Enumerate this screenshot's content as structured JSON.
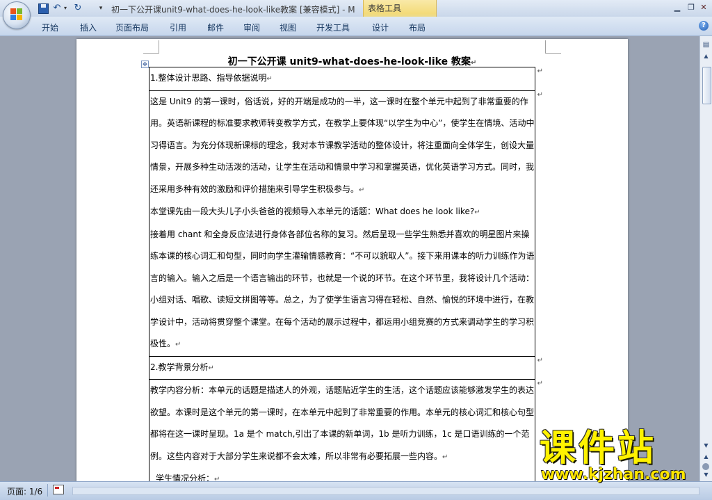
{
  "window": {
    "title": "初一下公开课unit9-what-does-he-look-like教案 [兼容模式] - M",
    "context_tab_group": "表格工具",
    "controls": {
      "minimize": "▁",
      "restore": "❐",
      "close": "✕"
    }
  },
  "quick_access": {
    "save_icon": "save-icon",
    "undo_glyph": "↶",
    "undo_drop": "▾",
    "redo_glyph": "↻",
    "more_glyph": "▾"
  },
  "ribbon": {
    "tabs": [
      "开始",
      "插入",
      "页面布局",
      "引用",
      "邮件",
      "审阅",
      "视图",
      "开发工具",
      "设计",
      "布局"
    ],
    "help_glyph": "?"
  },
  "document": {
    "heading": "初一下公开课 unit9-what-does-he-look-like 教案",
    "table_anchor_glyph": "✥",
    "para_mark": "↵",
    "rows": [
      {
        "paragraphs": [
          "1.整体设计思路、指导依据说明"
        ]
      },
      {
        "paragraphs": [
          "这是 Unit9 的第一课时，俗话说，好的开端是成功的一半，这一课时在整个单元中起到了非常重要的作用。英语新课程的标准要求教师转变教学方式，在教学上要体现“以学生为中心”，使学生在情境、活动中习得语言。为充分体现新课标的理念，我对本节课教学活动的整体设计，将注重面向全体学生，创设大量情景，开展多种生动活泼的活动，让学生在活动和情景中学习和掌握英语，优化英语学习方式。同时，我还采用多种有效的激励和评价措施来引导学生积极参与。",
          "本堂课先由一段大头儿子小头爸爸的视频导入本单元的话题：What does he look like?",
          "接着用 chant 和全身反应法进行身体各部位名称的复习。然后呈现一些学生熟悉并喜欢的明星图片来操练本课的核心词汇和句型，同时向学生灌输情感教育：“不可以貌取人”。接下来用课本的听力训练作为语言的输入。输入之后是一个语言输出的环节，也就是一个说的环节。在这个环节里，我将设计几个活动：小组对话、唱歌、读短文拼图等等。总之，为了使学生语言习得在轻松、自然、愉悦的环境中进行，在教学设计中，活动将贯穿整个课堂。在每个活动的展示过程中，都运用小组竞赛的方式来调动学生的学习积极性。"
        ]
      },
      {
        "paragraphs": [
          "2.教学背景分析"
        ]
      },
      {
        "paragraphs": [
          "教学内容分析：本单元的话题是描述人的外观，话题贴近学生的生活，这个话题应该能够激发学生的表达欲望。本课时是这个单元的第一课时，在本单元中起到了非常重要的作用。本单元的核心词汇和核心句型都将在这一课时呈现。1a 是个 match,引出了本课的新单词，1b 是听力训练，1c 是口语训练的一个范例。这些内容对于大部分学生来说都不会太难，所以非常有必要拓展一些内容。",
          "学生情况分析："
        ]
      }
    ]
  },
  "status_bar": {
    "page_indicator": "页面: 1/6"
  },
  "scrollbar": {
    "up": "▲",
    "down": "▼",
    "prev": "▲",
    "next": "▼",
    "ruler_glyph": "▤"
  },
  "watermark": {
    "main": "课件站",
    "url": "www.kjzhan.com"
  },
  "colors": {
    "ribbon_bg": "#c6d6ec",
    "context_tab": "#f3db7a",
    "watermark": "#fff200"
  }
}
